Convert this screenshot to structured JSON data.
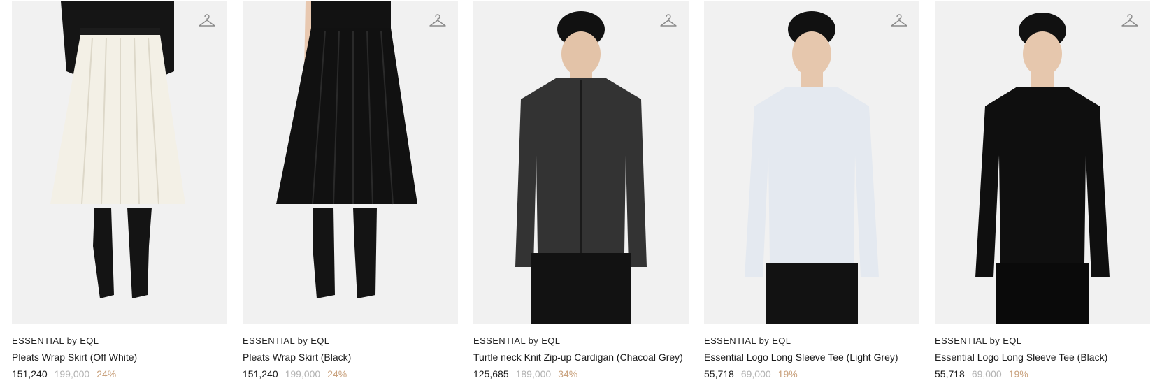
{
  "colors": {
    "image_bg": "#f1f1f1",
    "discount": "#c9a27e",
    "original_price": "#b3b3b3",
    "text": "#1a1a1a"
  },
  "icons": {
    "wishlist": "hanger-icon"
  },
  "products": [
    {
      "brand": "ESSENTIAL by EQL",
      "name": "Pleats Wrap Skirt (Off White)",
      "price": "151,240",
      "original_price": "199,000",
      "discount": "24%",
      "image": "white-pleated-skirt-with-black-boots"
    },
    {
      "brand": "ESSENTIAL by EQL",
      "name": "Pleats Wrap Skirt (Black)",
      "price": "151,240",
      "original_price": "199,000",
      "discount": "24%",
      "image": "black-pleated-skirt-with-black-boots"
    },
    {
      "brand": "ESSENTIAL by EQL",
      "name": "Turtle neck Knit Zip-up Cardigan (Chacoal Grey)",
      "price": "125,685",
      "original_price": "189,000",
      "discount": "34%",
      "image": "charcoal-zip-cardigan-model"
    },
    {
      "brand": "ESSENTIAL by EQL",
      "name": "Essential Logo Long Sleeve Tee (Light Grey)",
      "price": "55,718",
      "original_price": "69,000",
      "discount": "19%",
      "image": "light-grey-long-sleeve-tee-model"
    },
    {
      "brand": "ESSENTIAL by EQL",
      "name": "Essential Logo Long Sleeve Tee (Black)",
      "price": "55,718",
      "original_price": "69,000",
      "discount": "19%",
      "image": "black-long-sleeve-tee-model"
    }
  ]
}
